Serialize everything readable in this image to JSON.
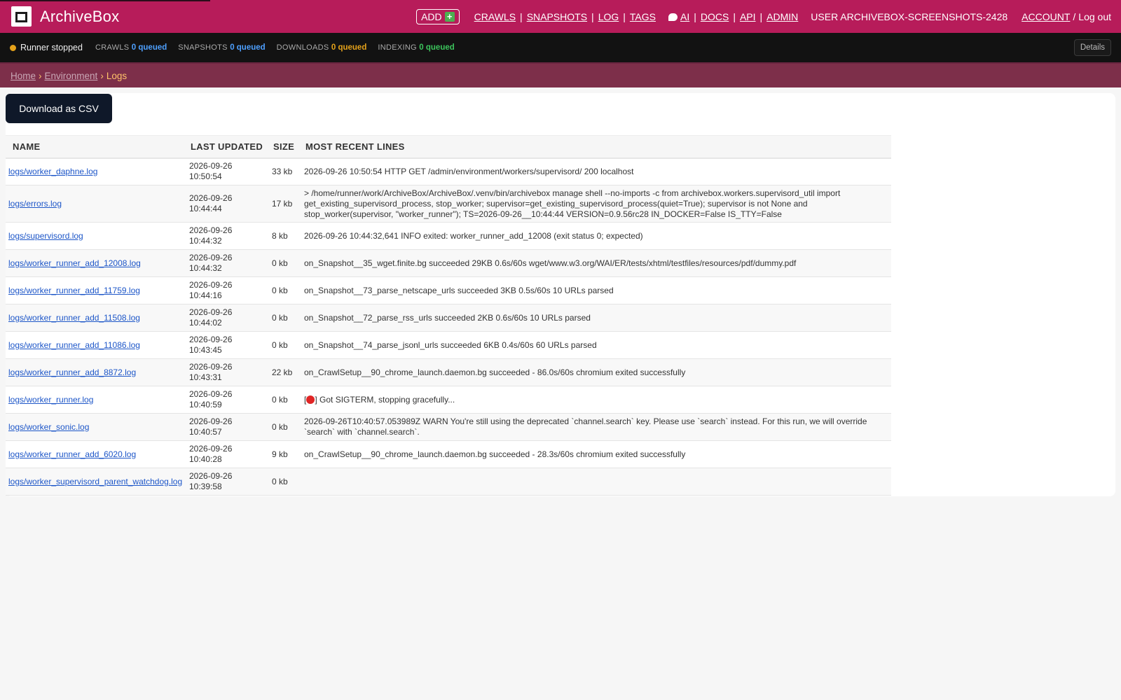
{
  "header": {
    "brand": "ArchiveBox",
    "add_label": "ADD",
    "nav_left": [
      "CRAWLS",
      "SNAPSHOTS",
      "LOG",
      "TAGS"
    ],
    "nav_mid": [
      "AI",
      "DOCS",
      "API",
      "ADMIN"
    ],
    "user_label": "USER ARCHIVEBOX-SCREENSHOTS-2428",
    "account_label": "ACCOUNT",
    "logout_label": "Log out"
  },
  "status": {
    "runner": "Runner stopped",
    "crawls_label": "CRAWLS",
    "crawls_value": "0 queued",
    "snapshots_label": "SNAPSHOTS",
    "snapshots_value": "0 queued",
    "downloads_label": "DOWNLOADS",
    "downloads_value": "0 queued",
    "indexing_label": "INDEXING",
    "indexing_value": "0 queued",
    "details_label": "Details",
    "colors": {
      "crawls": "#4ea0ff",
      "snapshots": "#4ea0ff",
      "downloads": "#e5a21a",
      "indexing": "#3cc45c",
      "runner_dot": "#e5a21a"
    }
  },
  "breadcrumb": {
    "home": "Home",
    "environment": "Environment",
    "current": "Logs"
  },
  "main": {
    "csv_button": "Download as CSV",
    "columns": [
      "NAME",
      "LAST UPDATED",
      "SIZE",
      "MOST RECENT LINES"
    ],
    "rows": [
      {
        "name": "logs/worker_daphne.log",
        "date": "2026-09-26",
        "time": "10:50:54",
        "size": "33 kb",
        "lines": "2026-09-26 10:50:54 HTTP GET /admin/environment/workers/supervisord/ 200 localhost"
      },
      {
        "name": "logs/errors.log",
        "date": "2026-09-26",
        "time": "10:44:44",
        "size": "17 kb",
        "lines": "> /home/runner/work/ArchiveBox/ArchiveBox/.venv/bin/archivebox manage shell --no-imports -c from archivebox.workers.supervisord_util import get_existing_supervisord_process, stop_worker; supervisor=get_existing_supervisord_process(quiet=True); supervisor is not None and stop_worker(supervisor, \"worker_runner\"); TS=2026-09-26__10:44:44 VERSION=0.9.56rc28 IN_DOCKER=False IS_TTY=False"
      },
      {
        "name": "logs/supervisord.log",
        "date": "2026-09-26",
        "time": "10:44:32",
        "size": "8 kb",
        "lines": "2026-09-26 10:44:32,641 INFO exited: worker_runner_add_12008 (exit status 0; expected)"
      },
      {
        "name": "logs/worker_runner_add_12008.log",
        "date": "2026-09-26",
        "time": "10:44:32",
        "size": "0 kb",
        "lines": "on_Snapshot__35_wget.finite.bg succeeded 29KB 0.6s/60s wget/www.w3.org/WAI/ER/tests/xhtml/testfiles/resources/pdf/dummy.pdf"
      },
      {
        "name": "logs/worker_runner_add_11759.log",
        "date": "2026-09-26",
        "time": "10:44:16",
        "size": "0 kb",
        "lines": "on_Snapshot__73_parse_netscape_urls succeeded 3KB 0.5s/60s 10 URLs parsed"
      },
      {
        "name": "logs/worker_runner_add_11508.log",
        "date": "2026-09-26",
        "time": "10:44:02",
        "size": "0 kb",
        "lines": "on_Snapshot__72_parse_rss_urls succeeded 2KB 0.6s/60s 10 URLs parsed"
      },
      {
        "name": "logs/worker_runner_add_11086.log",
        "date": "2026-09-26",
        "time": "10:43:45",
        "size": "0 kb",
        "lines": "on_Snapshot__74_parse_jsonl_urls succeeded 6KB 0.4s/60s 60 URLs parsed"
      },
      {
        "name": "logs/worker_runner_add_8872.log",
        "date": "2026-09-26",
        "time": "10:43:31",
        "size": "22 kb",
        "lines": "on_CrawlSetup__90_chrome_launch.daemon.bg succeeded - 86.0s/60s chromium exited successfully"
      },
      {
        "name": "logs/worker_runner.log",
        "date": "2026-09-26",
        "time": "10:40:59",
        "size": "0 kb",
        "lines_prefix": "[",
        "lines_icon": "stop-sign-icon",
        "lines": "] Got SIGTERM, stopping gracefully..."
      },
      {
        "name": "logs/worker_sonic.log",
        "date": "2026-09-26",
        "time": "10:40:57",
        "size": "0 kb",
        "lines": "2026-09-26T10:40:57.053989Z WARN You're still using the deprecated `channel.search` key. Please use `search` instead. For this run, we will override `search` with `channel.search`."
      },
      {
        "name": "logs/worker_runner_add_6020.log",
        "date": "2026-09-26",
        "time": "10:40:28",
        "size": "9 kb",
        "lines": "on_CrawlSetup__90_chrome_launch.daemon.bg succeeded - 28.3s/60s chromium exited successfully"
      },
      {
        "name": "logs/worker_supervisord_parent_watchdog.log",
        "date": "2026-09-26",
        "time": "10:39:58",
        "size": "0 kb",
        "lines": ""
      }
    ]
  }
}
